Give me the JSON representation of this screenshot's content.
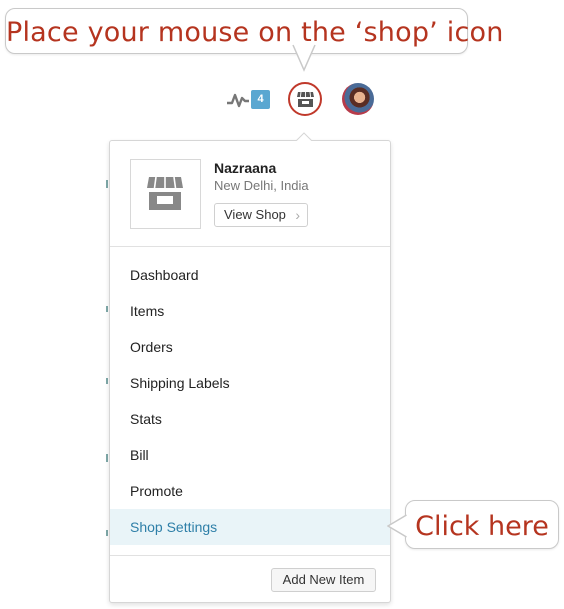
{
  "annotations": {
    "top_callout": "Place your mouse on the ‘shop’ icon",
    "right_callout": "Click here"
  },
  "header": {
    "activity_icon": "activity-pulse-icon",
    "notification_count": "4",
    "shop_icon": "storefront-icon",
    "avatar_icon": "user-avatar"
  },
  "shop": {
    "name": "Nazraana",
    "location": "New Delhi, India",
    "view_shop_label": "View Shop",
    "thumbnail_icon": "storefront-icon"
  },
  "menu": {
    "items": [
      {
        "label": "Dashboard"
      },
      {
        "label": "Items"
      },
      {
        "label": "Orders"
      },
      {
        "label": "Shipping Labels"
      },
      {
        "label": "Stats"
      },
      {
        "label": "Bill"
      },
      {
        "label": "Promote"
      },
      {
        "label": "Shop Settings",
        "active": true
      }
    ]
  },
  "footer": {
    "add_item_label": "Add New Item"
  },
  "colors": {
    "callout_text": "#b5341f",
    "active_link": "#2e7fa8",
    "active_bg": "#e9f4f8",
    "badge_bg": "#5aa7d1",
    "shop_ring": "#c0392b"
  }
}
